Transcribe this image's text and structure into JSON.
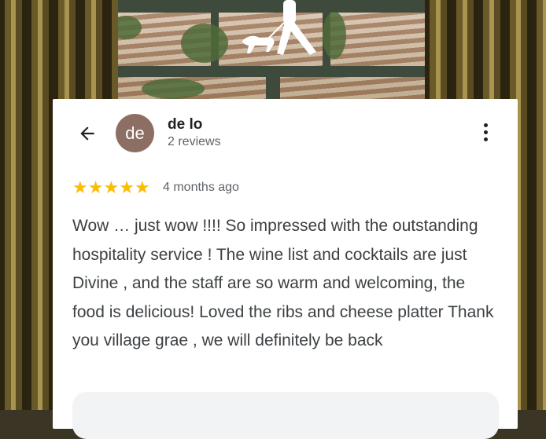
{
  "review": {
    "back_icon": "arrow-left-icon",
    "avatar_initials": "de",
    "avatar_color": "#8d6e63",
    "reviewer_name": "de lo",
    "review_count": "2 reviews",
    "more_icon": "more-vert-icon",
    "rating": 5,
    "star_color": "#fbbc04",
    "stars": [
      "★",
      "★",
      "★",
      "★",
      "★"
    ],
    "time_ago": "4 months ago",
    "text": "Wow … just wow !!!! So impressed with the outstanding hospitality service ! The wine list and cocktails are just Divine , and the staff are so warm and welcoming, the food is delicious! Loved the ribs and cheese platter Thank you village grae , we will definitely be back"
  }
}
